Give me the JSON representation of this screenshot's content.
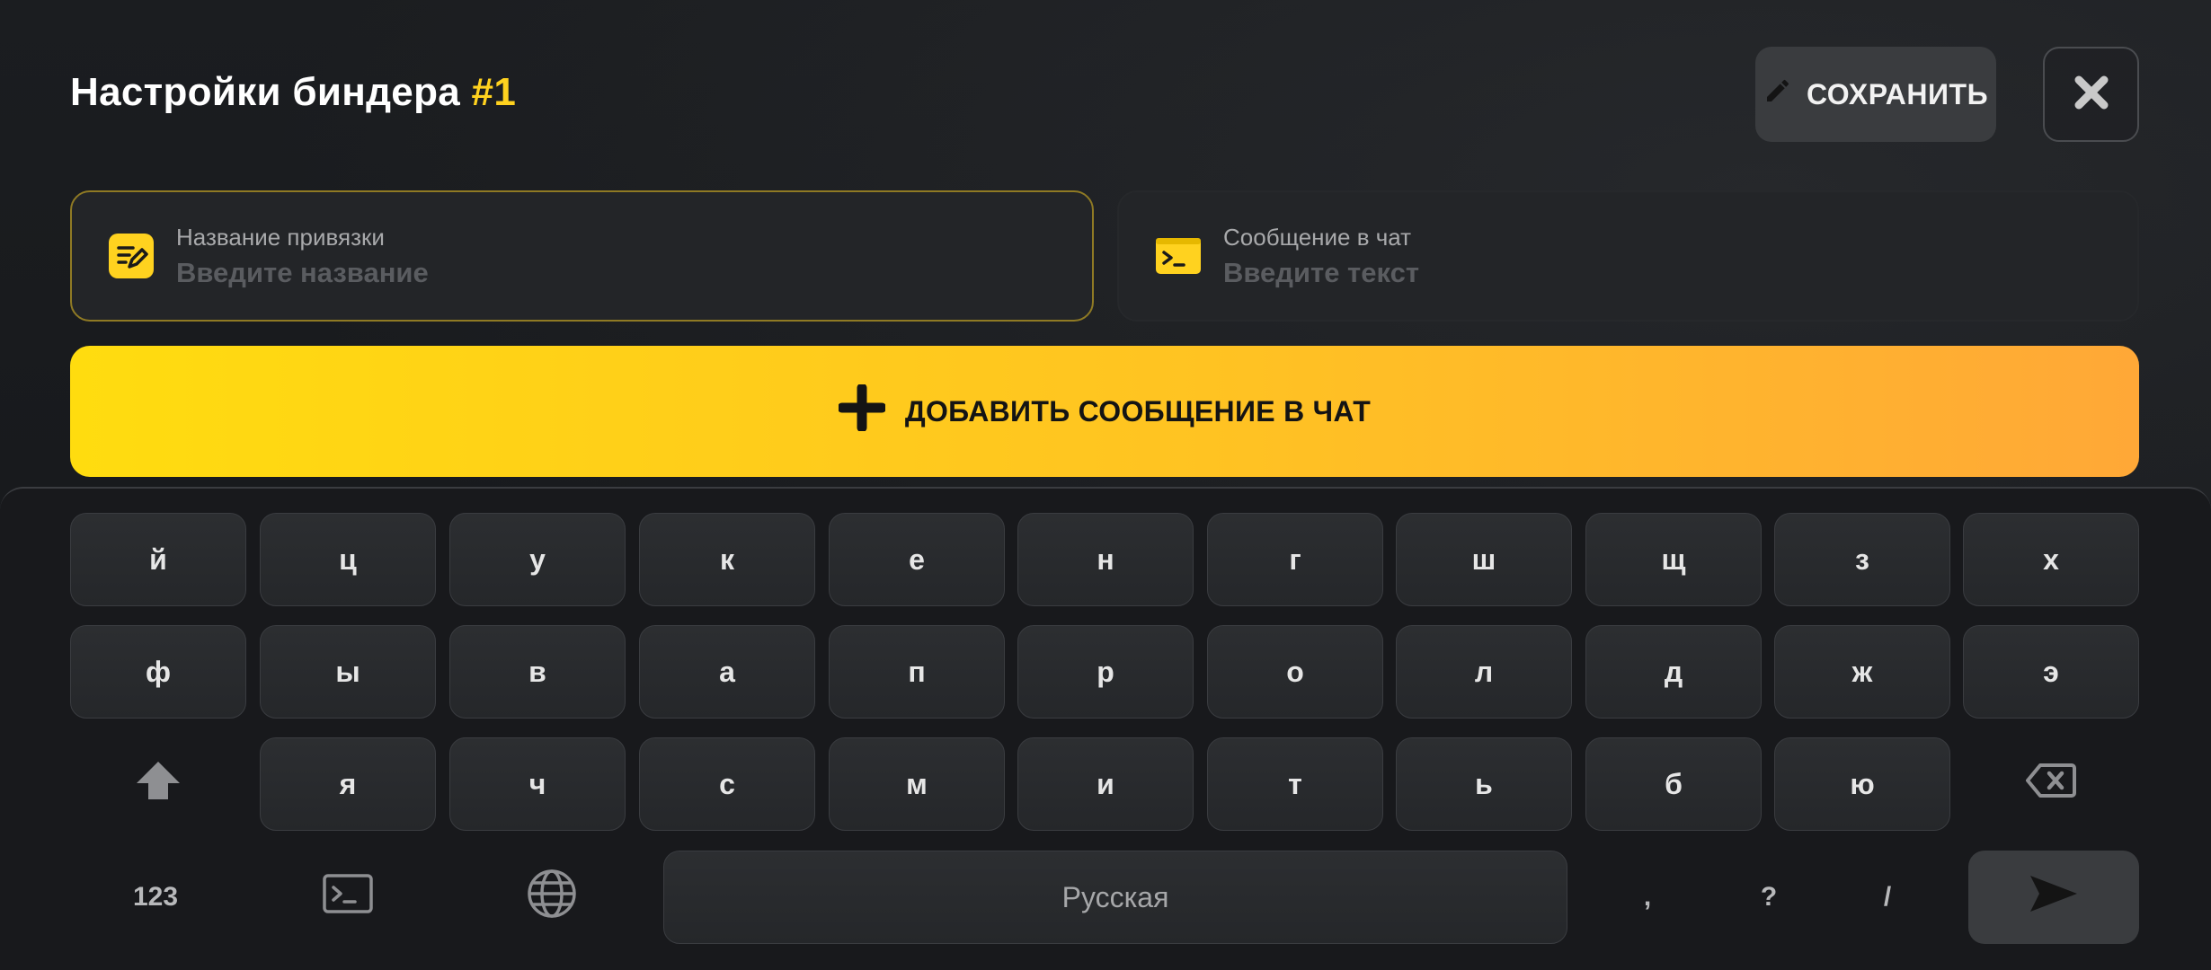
{
  "header": {
    "title": "Настройки биндера",
    "title_accent": "#1",
    "save_label": "СОХРАНИТЬ"
  },
  "fields": {
    "name": {
      "label": "Название привязки",
      "placeholder": "Введите название",
      "value": ""
    },
    "message": {
      "label": "Сообщение в чат",
      "placeholder": "Введите текст",
      "value": ""
    }
  },
  "add_button": {
    "label": "ДОБАВИТЬ СООБЩЕНИЕ В ЧАТ"
  },
  "keyboard": {
    "row1": [
      "й",
      "ц",
      "у",
      "к",
      "е",
      "н",
      "г",
      "ш",
      "щ",
      "з",
      "х"
    ],
    "row2": [
      "ф",
      "ы",
      "в",
      "а",
      "п",
      "р",
      "о",
      "л",
      "д",
      "ж",
      "э"
    ],
    "row3": [
      "я",
      "ч",
      "с",
      "м",
      "и",
      "т",
      "ь",
      "б",
      "ю"
    ],
    "numbers_label": "123",
    "space_label": "Русская",
    "comma": ",",
    "question": "?",
    "slash": "/"
  },
  "colors": {
    "accent": "#ffd21f",
    "gradient_start": "#ffdc0f",
    "gradient_end": "#ffa837",
    "background": "#15171a",
    "key": "#2a2c2f"
  },
  "icons": {
    "save": "pencil-icon",
    "close": "close-icon",
    "name_field": "edit-note-icon",
    "message_field": "terminal-icon",
    "add": "plus-icon",
    "shift": "shift-arrow-icon",
    "backspace": "backspace-icon",
    "terminal": "terminal-icon",
    "language": "globe-icon",
    "send": "send-arrow-icon"
  }
}
